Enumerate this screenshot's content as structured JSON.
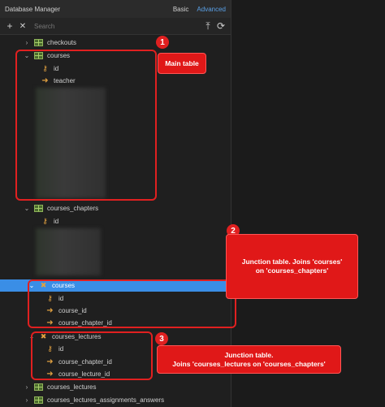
{
  "titlebar": {
    "title": "Database Manager",
    "mode_basic": "Basic",
    "mode_advanced": "Advanced"
  },
  "toolbar": {
    "add_label": "+",
    "close_label": "✕",
    "search_placeholder": "Search",
    "upload_label": "⤒",
    "refresh_label": "⟳"
  },
  "tree": {
    "checkouts": "checkouts",
    "courses": "courses",
    "courses_id": "id",
    "courses_teacher": "teacher",
    "courses_chapters": "courses_chapters",
    "chapters_id": "id",
    "junction_courses": "courses",
    "junction_id": "id",
    "junction_course_id": "course_id",
    "junction_course_chapter_id": "course_chapter_id",
    "courses_lectures": "courses_lectures",
    "lectures_id": "id",
    "lectures_course_chapter_id": "course_chapter_id",
    "lectures_course_lecture_id": "course_lecture_id",
    "courses_lectures_bottom": "courses_lectures",
    "assignments_answers": "courses_lectures_assignments_answers"
  },
  "annotations": {
    "badge1": "1",
    "callout1": "Main table",
    "badge2": "2",
    "callout2_line1": "Junction table. Joins 'courses'",
    "callout2_line2": "on 'courses_chapters'",
    "badge3": "3",
    "callout3_line1": "Junction table.",
    "callout3_line2": "Joins 'courses_lectures on 'courses_chapters'"
  },
  "colors": {
    "accent": "#3a8ee6",
    "annotation": "#e02020",
    "table_icon": "#8fb35a",
    "key_icon": "#e0a040"
  }
}
